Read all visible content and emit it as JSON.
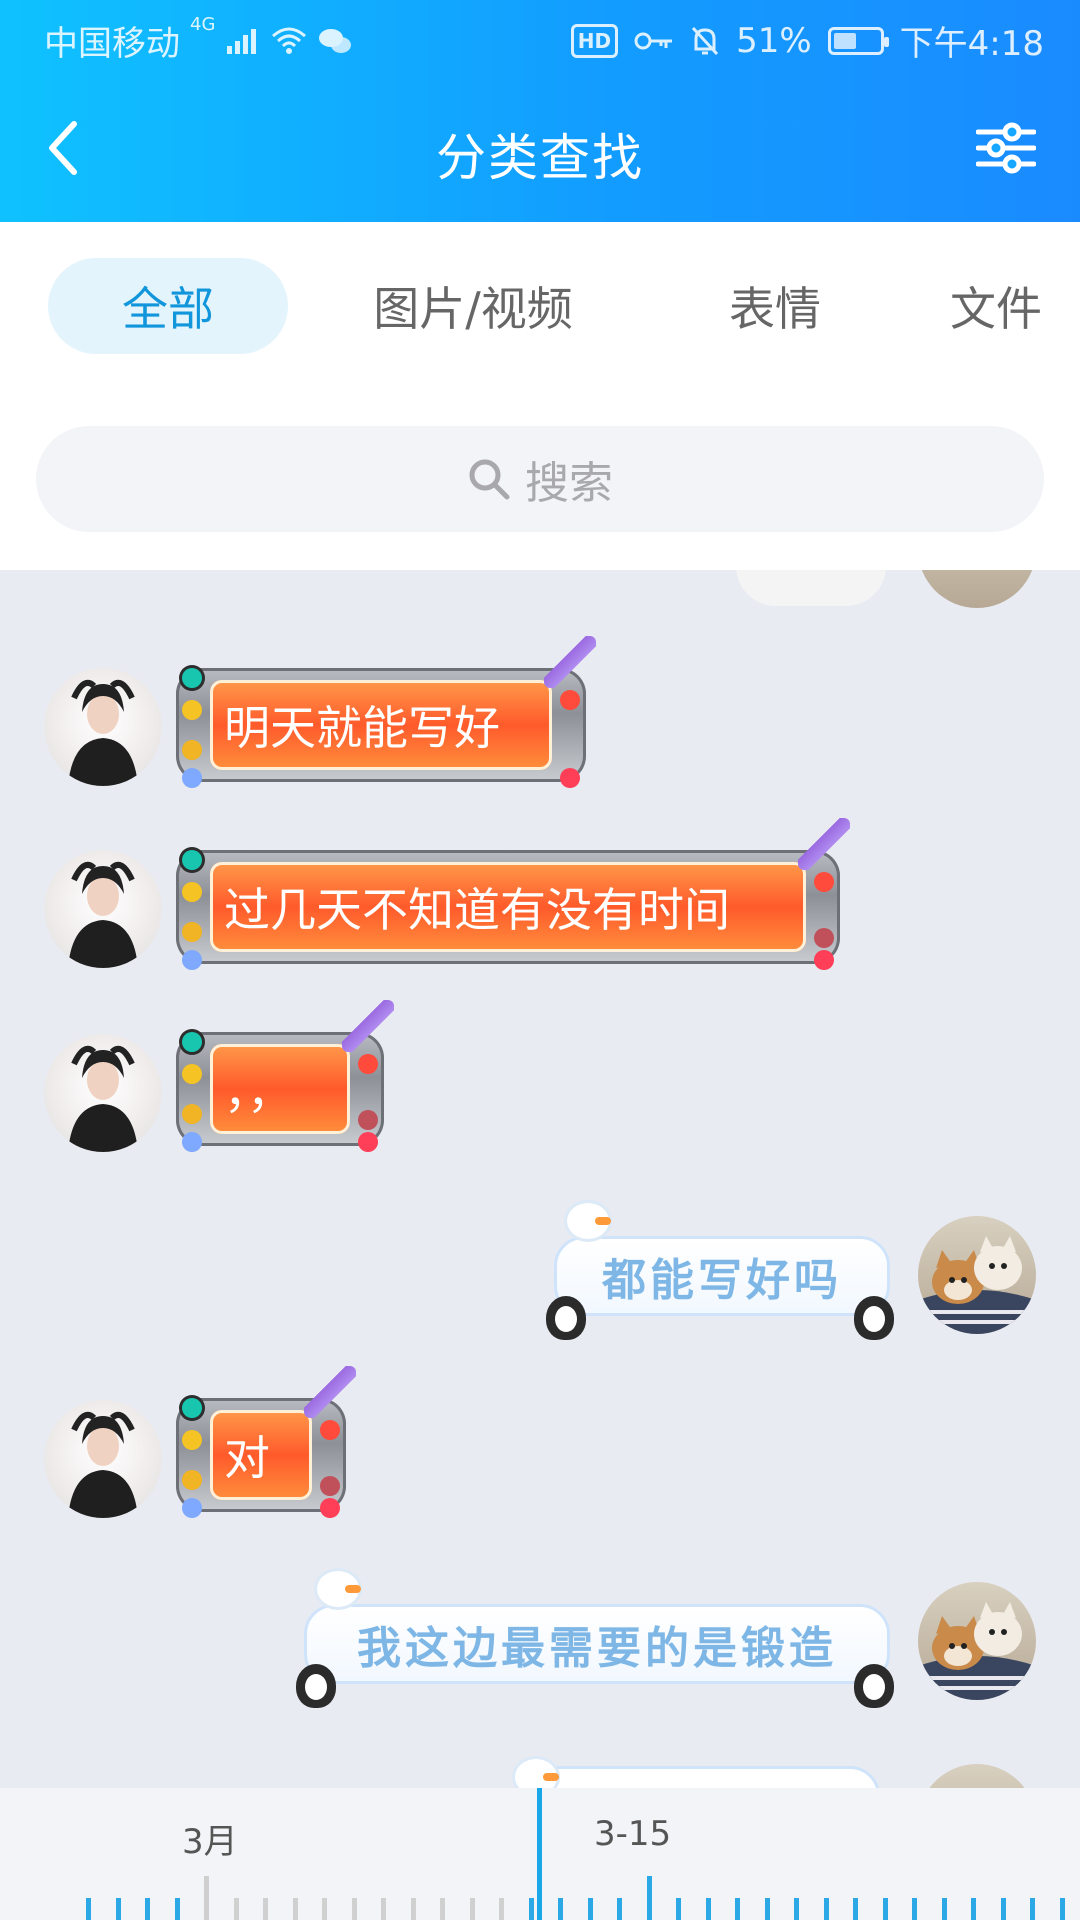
{
  "status_bar": {
    "carrier": "中国移动",
    "network": "4G",
    "hd": "HD",
    "battery_pct": "51%",
    "battery_level": 0.51,
    "time": "下午4:18"
  },
  "nav": {
    "title": "分类查找",
    "back_icon": "chevron-left-icon",
    "filter_icon": "sliders-icon"
  },
  "tabs": [
    {
      "label": "全部",
      "active": true
    },
    {
      "label": "图片/视频",
      "active": false
    },
    {
      "label": "表情",
      "active": false
    },
    {
      "label": "文件",
      "active": false
    }
  ],
  "search": {
    "placeholder": "搜索"
  },
  "messages": [
    {
      "side": "left",
      "style": "metal",
      "text": "明天就能写好"
    },
    {
      "side": "left",
      "style": "metal",
      "text": "过几天不知道有没有时间"
    },
    {
      "side": "left",
      "style": "metal",
      "text": "，，"
    },
    {
      "side": "right",
      "style": "snow",
      "text": "都能写好吗"
    },
    {
      "side": "left",
      "style": "metal",
      "text": "对"
    },
    {
      "side": "right",
      "style": "snow",
      "text": "我这边最需要的是锻造"
    }
  ],
  "timeline": {
    "labels": [
      "3月",
      "3-15"
    ]
  },
  "colors": {
    "accent": "#1296db",
    "header_start": "#0fc2ff",
    "header_end": "#1a8bff",
    "metal_bubble": "#ff5a2b",
    "snow_text": "#7eb7e6"
  }
}
